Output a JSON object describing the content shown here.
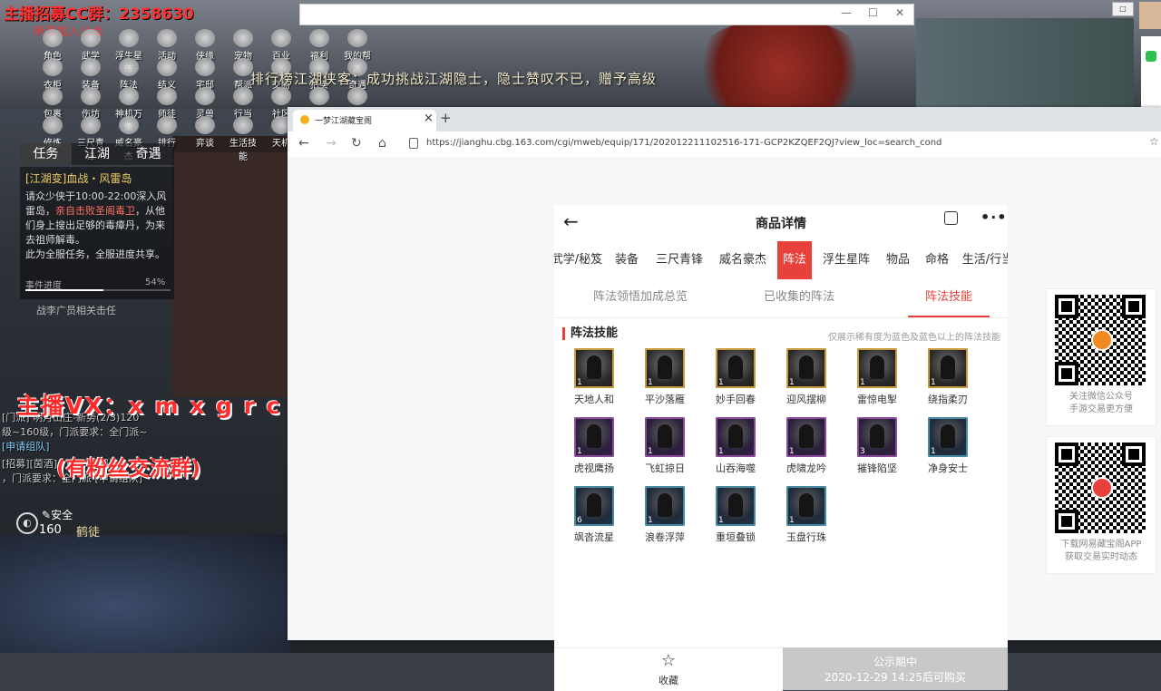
{
  "stream": {
    "title": "主播招募CC群：2358630",
    "subtitle": "申请加入公会",
    "vx": "主播VX：x m x g r c x",
    "fans": "(有粉丝交流群)"
  },
  "game": {
    "menu": [
      [
        "角色",
        "武学",
        "浮生星阵",
        "活动",
        "侠缘",
        "宠物",
        "百业",
        "福利",
        "我的帮派"
      ],
      [
        "衣柜",
        "装备",
        "阵法",
        "结义",
        "宅邸",
        "帮派",
        "交易",
        "拍卖",
        "奇遇"
      ],
      [
        "包裹",
        "伤坊",
        "神机万象",
        "师徒",
        "灵兽",
        "行当",
        "社区",
        "设置",
        "江湖"
      ],
      [
        "修炼",
        "三尺青锋",
        "威名豪杰",
        "排行",
        "弈谈",
        "生活技能",
        "天机"
      ]
    ],
    "marquee": "排行榜江湖侠客：成功挑战江湖隐士，隐士赞叹不已，赠予高级",
    "tabs": [
      "任务",
      "江湖",
      "奇遇"
    ],
    "task": {
      "name": "[江湖变]血战・风雷岛",
      "desc_a": "请众少侠于10:00-22:00深入风雷岛，",
      "desc_b": "亲自击败圣阁毒卫",
      "desc_c": "，从他们身上搜出足够的毒瘴丹，为来去祖师解毒。",
      "desc_d": "此为全服任务，全服进度共享。",
      "progress_label": "事件进度",
      "progress_pct": "54%",
      "progress": 0.54,
      "more": "战李广员相关击任"
    },
    "chat": [
      "[门派] 明月山庄-新势(2/3)120",
      "级~160级，门派要求：全门派~",
      "[申请组队]",
      "[招募][茵酒]~百~求组队~",
      "，门派要求：全门派 [申请组队]"
    ],
    "status": {
      "safe": "安全",
      "level": "160",
      "title": "鹤徒"
    }
  },
  "browser": {
    "tab_title": "一梦江湖藏宝阁",
    "url": "https://jianghu.cbg.163.com/cgi/mweb/equip/171/202012211102516-171-GCP2KZQEF2QJ?view_loc=search_cond"
  },
  "page": {
    "title": "商品详情",
    "categories": [
      "武学/秘笈",
      "装备",
      "三尺青锋",
      "威名豪杰",
      "阵法",
      "浮生星阵",
      "物品",
      "命格",
      "生活/行当",
      "外"
    ],
    "active_category": 4,
    "subtabs": [
      "阵法领悟加成总览",
      "已收集的阵法",
      "阵法技能"
    ],
    "active_subtab": 2,
    "section_title": "阵法技能",
    "section_note": "仅展示稀有度为蓝色及蓝色以上的阵法技能",
    "skills": [
      {
        "name": "天地人和",
        "level": "1",
        "rarity": "gold"
      },
      {
        "name": "平沙落雁",
        "level": "1",
        "rarity": "gold"
      },
      {
        "name": "妙手回春",
        "level": "1",
        "rarity": "gold"
      },
      {
        "name": "迎风摆柳",
        "level": "1",
        "rarity": "gold"
      },
      {
        "name": "雷惊电掣",
        "level": "1",
        "rarity": "gold"
      },
      {
        "name": "绕指柔刃",
        "level": "1",
        "rarity": "gold"
      },
      {
        "name": "虎视鹰扬",
        "level": "1",
        "rarity": "purple"
      },
      {
        "name": "飞虹掠日",
        "level": "1",
        "rarity": "purple"
      },
      {
        "name": "山吞海噬",
        "level": "1",
        "rarity": "purple"
      },
      {
        "name": "虎啸龙吟",
        "level": "1",
        "rarity": "purple"
      },
      {
        "name": "摧锋陷坚",
        "level": "3",
        "rarity": "purple"
      },
      {
        "name": "净身安士",
        "level": "1",
        "rarity": "blue"
      },
      {
        "name": "飒沓流星",
        "level": "6",
        "rarity": "blue"
      },
      {
        "name": "浪卷浮萍",
        "level": "1",
        "rarity": "blue"
      },
      {
        "name": "重垣叠锁",
        "level": "1",
        "rarity": "blue"
      },
      {
        "name": "玉盘行珠",
        "level": "1",
        "rarity": "blue"
      }
    ],
    "bottom": {
      "fav": "收藏",
      "status1": "公示期中",
      "status2": "2020-12-29 14:25后可购买"
    }
  },
  "qr": [
    {
      "line1": "关注微信公众号",
      "line2": "手游交易更方便"
    },
    {
      "line1": "下载网易藏宝阁APP",
      "line2": "获取交易实时动态"
    }
  ],
  "colors": {
    "accent": "#e8403a",
    "disabled": "#c8c8c8"
  }
}
